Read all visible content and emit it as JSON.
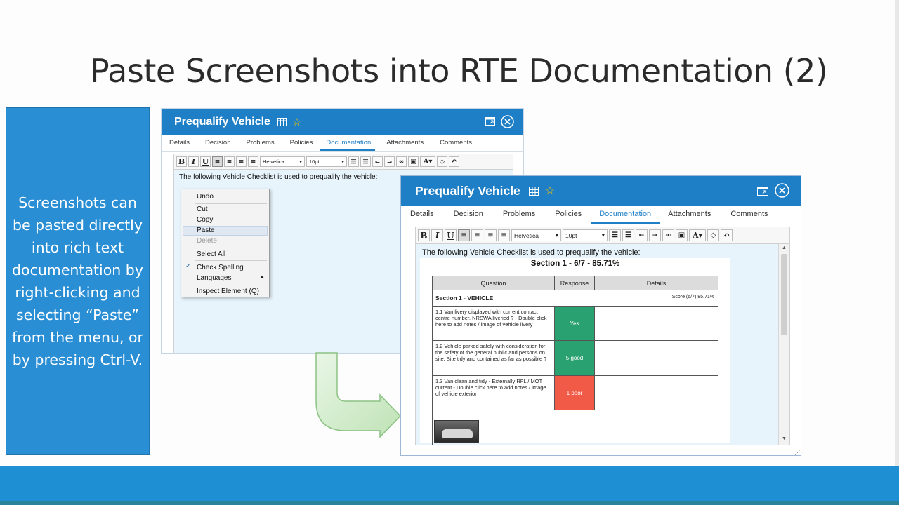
{
  "slide": {
    "title": "Paste Screenshots into RTE Documentation (2)",
    "description": "Screenshots can be pasted directly into rich text documentation by right-clicking and selecting “Paste” from the menu, or by pressing Ctrl-V."
  },
  "colors": {
    "header_blue": "#1e7fc6",
    "panel_blue": "#2a8ed4",
    "editor_bg": "#e8f4fc",
    "response_yes": "#2aa170",
    "response_good": "#2aa170",
    "response_poor": "#f05a46"
  },
  "window_back": {
    "title": "Prequalify Vehicle",
    "tabs": [
      "Details",
      "Decision",
      "Problems",
      "Policies",
      "Documentation",
      "Attachments",
      "Comments"
    ],
    "active_tab": "Documentation",
    "font_family": "Helvetica",
    "font_size": "10pt",
    "editor_text": "The following Vehicle Checklist is used to prequalify the vehicle:"
  },
  "context_menu": {
    "items": [
      "Undo",
      "Cut",
      "Copy",
      "Paste",
      "Delete",
      "Select All",
      "Check Spelling",
      "Languages",
      "Inspect Element (Q)"
    ],
    "highlighted": "Paste",
    "disabled": "Delete",
    "checked": "Check Spelling"
  },
  "window_front": {
    "title": "Prequalify Vehicle",
    "tabs": [
      "Details",
      "Decision",
      "Problems",
      "Policies",
      "Documentation",
      "Attachments",
      "Comments"
    ],
    "active_tab": "Documentation",
    "font_family": "Helvetica",
    "font_size": "10pt",
    "editor_text": "The following Vehicle Checklist is used to prequalify the vehicle:",
    "checklist": {
      "heading": "Section 1 - 6/7 - 85.71%",
      "columns": [
        "Question",
        "Response",
        "Details"
      ],
      "section_label": "Section 1 - VEHICLE",
      "section_score": "Score (6/7) 85.71%",
      "rows": [
        {
          "question": "1.1 Van livery displayed with current contact centre number. NRSWA liveried ? - Double click here to add notes / image of vehicle livery",
          "response": "Yes"
        },
        {
          "question": "1.2 Vehicle parked safely with consideration for the safety of the general public and persons on site. Site tidy and contained as far as possible ?",
          "response": "5 good"
        },
        {
          "question": "1.3 Van clean and tidy - Externally RFL / MOT current - Double click here to add notes / image of vehicle exterior",
          "response": "1 poor"
        }
      ]
    }
  },
  "icons": [
    "table-icon",
    "star-icon",
    "popout-icon",
    "close-icon"
  ]
}
